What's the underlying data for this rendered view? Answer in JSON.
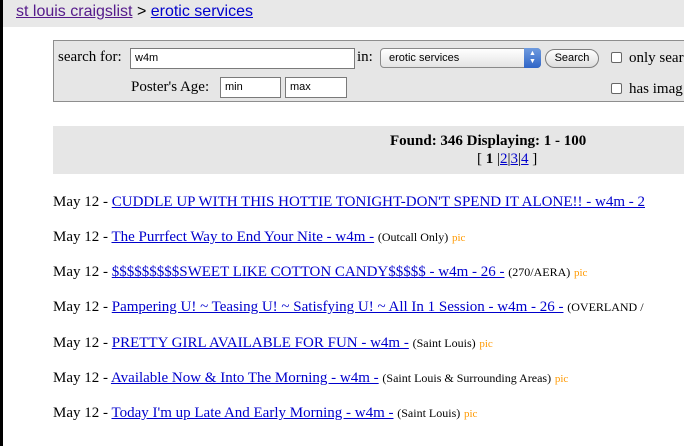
{
  "header": {
    "site_link": "st louis craigslist",
    "separator": ">",
    "section_link": "erotic services"
  },
  "search": {
    "search_label": "search for:",
    "query_value": "w4m",
    "in_label": "in:",
    "category_selected": "erotic services",
    "search_button": "Search",
    "only_search_label": "only sear",
    "age_label": "Poster's Age:",
    "age_min": "min",
    "age_max": "max",
    "has_image_label": "has imag"
  },
  "results": {
    "found_text": "Found: 346 Displaying: 1 - 100",
    "pager": {
      "open": "[",
      "current": "1",
      "pages": [
        "2",
        "3",
        "4"
      ],
      "close": "]"
    }
  },
  "listings": [
    {
      "date": "May 12 -",
      "title": "CUDDLE UP WITH THIS HOTTIE TONIGHT-DON'T SPEND IT ALONE!! - w4m - 2",
      "location": "",
      "pic": ""
    },
    {
      "date": "May 12 -",
      "title": "The Purrfect Way to End Your Nite - w4m -",
      "location": "(Outcall Only)",
      "pic": "pic"
    },
    {
      "date": "May 12 -",
      "title": "$$$$$$$$$SWEET LIKE COTTON CANDY$$$$$ - w4m - 26 -",
      "location": "(270/AERA)",
      "pic": "pic"
    },
    {
      "date": "May 12 -",
      "title": "Pampering U! ~ Teasing U! ~ Satisfying U! ~ All In 1 Session - w4m - 26 -",
      "location": "(OVERLAND /",
      "pic": ""
    },
    {
      "date": "May 12 -",
      "title": "PRETTY GIRL AVAILABLE FOR FUN - w4m -",
      "location": "(Saint Louis)",
      "pic": "pic"
    },
    {
      "date": "May 12 -",
      "title": "Available Now & Into The Morning - w4m -",
      "location": "(Saint Louis & Surrounding Areas)",
      "pic": "pic"
    },
    {
      "date": "May 12 -",
      "title": "Today I'm up Late And Early Morning - w4m -",
      "location": "(Saint Louis)",
      "pic": "pic"
    }
  ]
}
